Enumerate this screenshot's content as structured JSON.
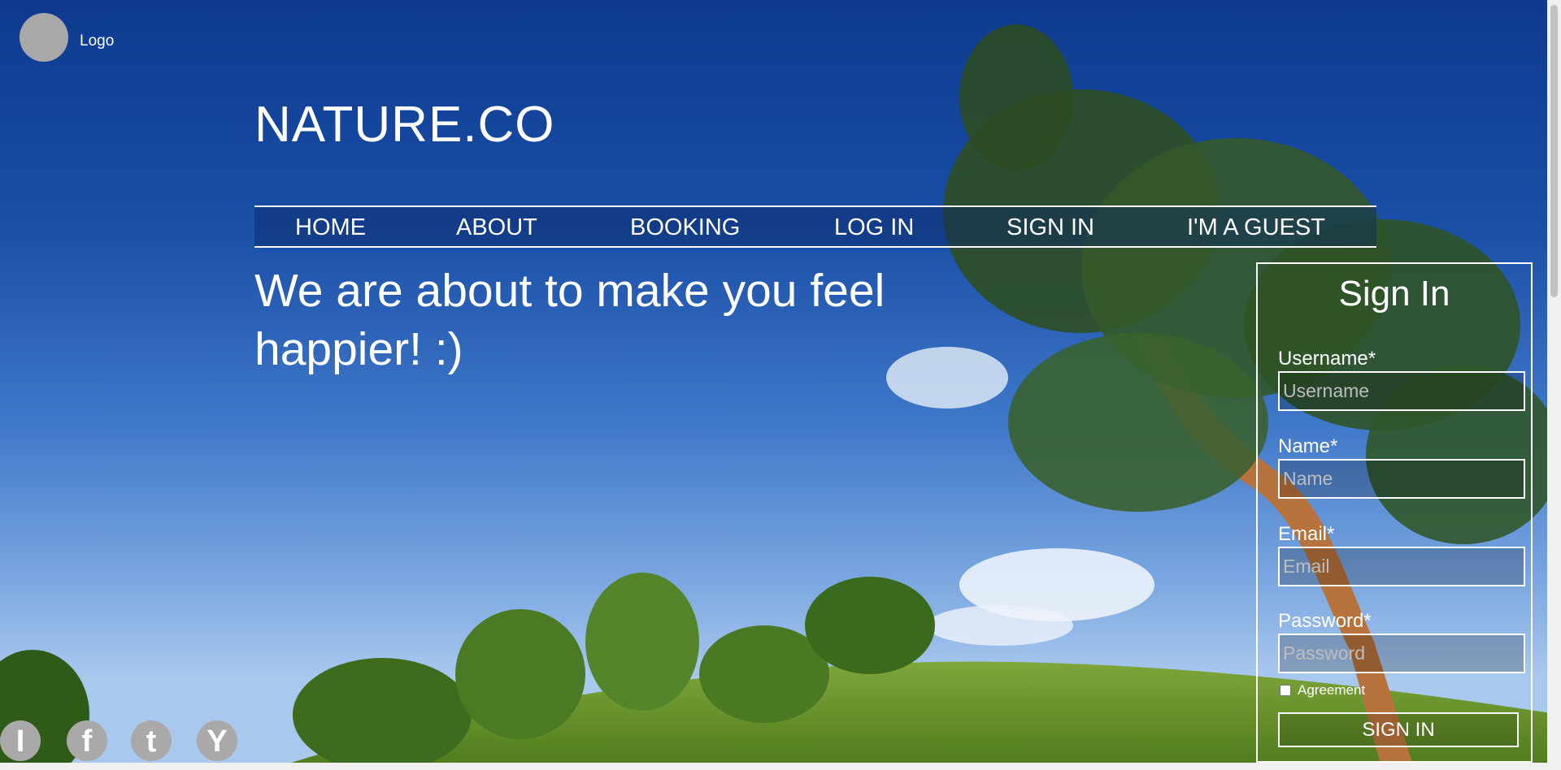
{
  "logo": {
    "text": "Logo"
  },
  "brand": {
    "title": "NATURE.CO"
  },
  "nav": {
    "items": [
      {
        "label": "HOME"
      },
      {
        "label": "ABOUT"
      },
      {
        "label": "BOOKING"
      },
      {
        "label": "LOG IN"
      },
      {
        "label": "SIGN IN"
      },
      {
        "label": "I'M A GUEST"
      }
    ]
  },
  "hero": {
    "headline": "We are about to make you feel happier! :)"
  },
  "signin": {
    "title": "Sign In",
    "fields": [
      {
        "label": "Username*",
        "placeholder": "Username"
      },
      {
        "label": "Name*",
        "placeholder": "Name"
      },
      {
        "label": "Email*",
        "placeholder": "Email"
      },
      {
        "label": "Password*",
        "placeholder": "Password"
      }
    ],
    "agreement_label": "Agreement",
    "button_label": "SIGN IN"
  },
  "social": {
    "items": [
      {
        "icon": "instagram-icon",
        "glyph": "I"
      },
      {
        "icon": "facebook-icon",
        "glyph": "f"
      },
      {
        "icon": "twitter-icon",
        "glyph": "t"
      },
      {
        "icon": "youtube-icon",
        "glyph": "Y"
      }
    ]
  }
}
